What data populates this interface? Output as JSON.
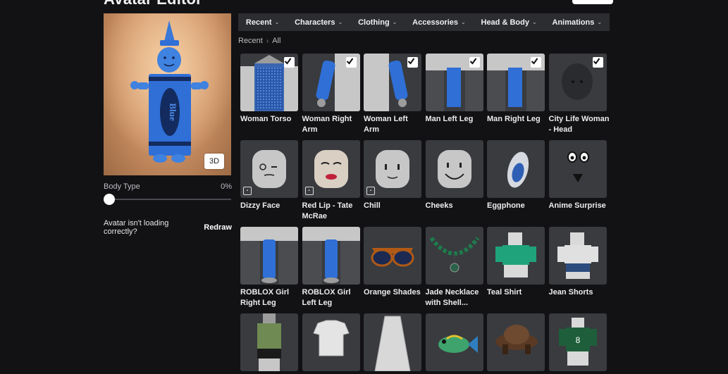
{
  "page": {
    "title": "Avatar Editor"
  },
  "avatar": {
    "view_3d_label": "3D",
    "crayon_text": "Blue"
  },
  "body_type": {
    "label": "Body Type",
    "value": "0%",
    "slider_value": 0
  },
  "loading": {
    "message": "Avatar isn't loading correctly?",
    "redraw_label": "Redraw"
  },
  "nav": {
    "tabs": [
      {
        "label": "Recent"
      },
      {
        "label": "Characters"
      },
      {
        "label": "Clothing"
      },
      {
        "label": "Accessories"
      },
      {
        "label": "Head & Body"
      },
      {
        "label": "Animations"
      }
    ]
  },
  "breadcrumb": {
    "root": "Recent",
    "current": "All"
  },
  "items": [
    {
      "label": "Woman Torso",
      "checked": true,
      "kind": "torso"
    },
    {
      "label": "Woman Right Arm",
      "checked": true,
      "kind": "rarm"
    },
    {
      "label": "Woman Left Arm",
      "checked": true,
      "kind": "larm"
    },
    {
      "label": "Man Left Leg",
      "checked": true,
      "kind": "leg"
    },
    {
      "label": "Man Right Leg",
      "checked": true,
      "kind": "leg"
    },
    {
      "label": "City Life Woman - Head",
      "checked": true,
      "kind": "head-dark"
    },
    {
      "label": "Dizzy Face",
      "editable": true,
      "kind": "face-dizzy"
    },
    {
      "label": "Red Lip - Tate McRae",
      "editable": true,
      "kind": "face-lip"
    },
    {
      "label": "Chill",
      "editable": true,
      "kind": "face-chill"
    },
    {
      "label": "Cheeks",
      "kind": "face-cheeks"
    },
    {
      "label": "Eggphone",
      "kind": "egg"
    },
    {
      "label": "Anime Surprise",
      "kind": "anime"
    },
    {
      "label": "ROBLOX Girl Right Leg",
      "kind": "girl-leg"
    },
    {
      "label": "ROBLOX Girl Left Leg",
      "kind": "girl-leg"
    },
    {
      "label": "Orange Shades",
      "kind": "shades"
    },
    {
      "label": "Jade Necklace with Shell...",
      "kind": "necklace"
    },
    {
      "label": "Teal Shirt",
      "kind": "shirt-teal"
    },
    {
      "label": "Jean Shorts",
      "kind": "shorts"
    },
    {
      "label": "",
      "kind": "tank"
    },
    {
      "label": "",
      "kind": "tshirt-white"
    },
    {
      "label": "",
      "kind": "skirt"
    },
    {
      "label": "",
      "kind": "fish"
    },
    {
      "label": "",
      "kind": "hat"
    },
    {
      "label": "",
      "kind": "jersey"
    }
  ],
  "colors": {
    "background": "#121215",
    "card": "#393b3f",
    "nav": "#2c2d31",
    "accent_blue": "#2f6fd6"
  }
}
